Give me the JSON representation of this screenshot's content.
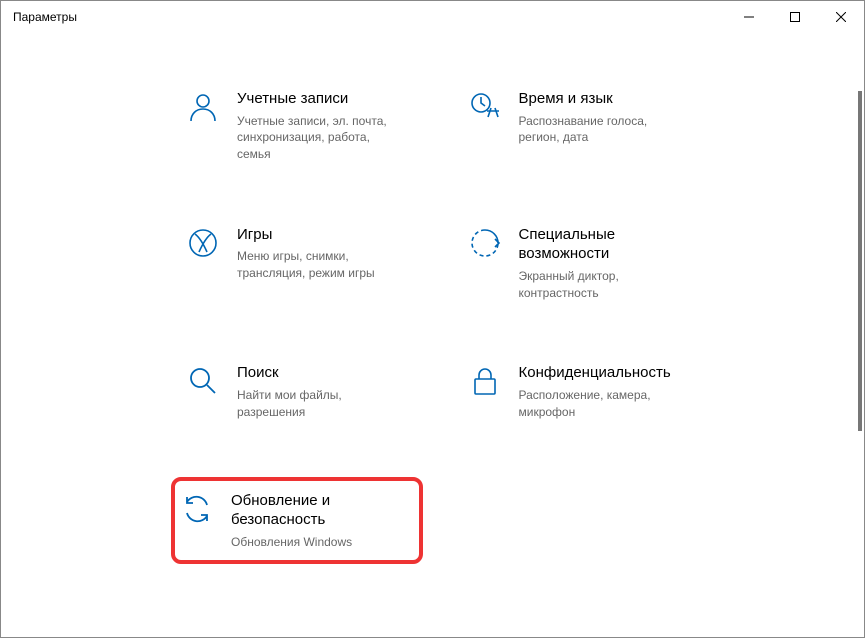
{
  "window": {
    "title": "Параметры"
  },
  "tiles": {
    "accounts": {
      "title": "Учетные записи",
      "desc": "Учетные записи, эл. почта, синхронизация, работа, семья"
    },
    "timeLanguage": {
      "title": "Время и язык",
      "desc": "Распознавание голоса, регион, дата"
    },
    "gaming": {
      "title": "Игры",
      "desc": "Меню игры, снимки, трансляция, режим игры"
    },
    "easeOfAccess": {
      "title": "Специальные возможности",
      "desc": "Экранный диктор, контрастность"
    },
    "search": {
      "title": "Поиск",
      "desc": "Найти мои файлы, разрешения"
    },
    "privacy": {
      "title": "Конфиденциальность",
      "desc": "Расположение, камера, микрофон"
    },
    "update": {
      "title": "Обновление и безопасность",
      "desc": "Обновления Windows"
    }
  }
}
